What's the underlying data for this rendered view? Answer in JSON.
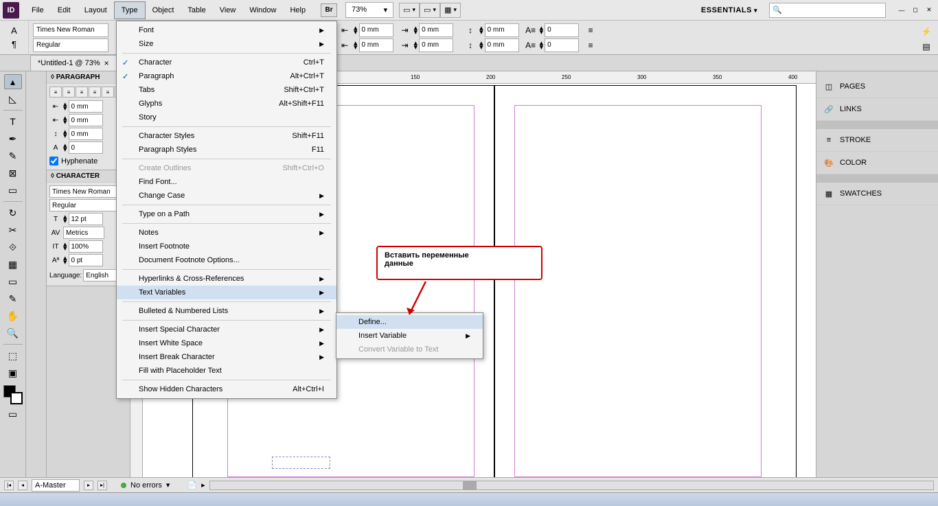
{
  "menubar": {
    "app": "ID",
    "items": [
      "File",
      "Edit",
      "Layout",
      "Type",
      "Object",
      "Table",
      "View",
      "Window",
      "Help"
    ],
    "active_index": 3,
    "br": "Br",
    "zoom": "73%",
    "workspace": "ESSENTIALS",
    "search_placeholder": ""
  },
  "controlbar": {
    "font_family": "Times New Roman",
    "font_style": "Regular",
    "indent_val": "0 mm",
    "space_val": "0 mm",
    "num_val": "0"
  },
  "doc_tab": {
    "title": "*Untitled-1 @ 73%"
  },
  "paragraph_panel": {
    "title": "◊ PARAGRAPH",
    "val_mm": "0 mm",
    "val_num": "0",
    "hyphenate": "Hyphenate"
  },
  "character_panel": {
    "title": "◊ CHARACTER",
    "font": "Times New Roman",
    "style": "Regular",
    "size": "12 pt",
    "metrics": "Metrics",
    "scale": "100%",
    "baseline": "0 pt",
    "lang_label": "Language:",
    "lang_value": "English"
  },
  "ruler_ticks": [
    "150",
    "200",
    "250",
    "300",
    "350",
    "400"
  ],
  "right_panels": {
    "pages": "PAGES",
    "links": "LINKS",
    "stroke": "STROKE",
    "color": "COLOR",
    "swatches": "SWATCHES"
  },
  "type_menu": {
    "font": "Font",
    "size": "Size",
    "character": {
      "label": "Character",
      "shortcut": "Ctrl+T"
    },
    "paragraph": {
      "label": "Paragraph",
      "shortcut": "Alt+Ctrl+T"
    },
    "tabs": {
      "label": "Tabs",
      "shortcut": "Shift+Ctrl+T"
    },
    "glyphs": {
      "label": "Glyphs",
      "shortcut": "Alt+Shift+F11"
    },
    "story": "Story",
    "char_styles": {
      "label": "Character Styles",
      "shortcut": "Shift+F11"
    },
    "para_styles": {
      "label": "Paragraph Styles",
      "shortcut": "F11"
    },
    "outlines": {
      "label": "Create Outlines",
      "shortcut": "Shift+Ctrl+O"
    },
    "find_font": "Find Font...",
    "change_case": "Change Case",
    "type_path": "Type on a Path",
    "notes": "Notes",
    "footnote": "Insert Footnote",
    "footnote_opts": "Document Footnote Options...",
    "hyperlinks": "Hyperlinks & Cross-References",
    "text_vars": "Text Variables",
    "bulleted": "Bulleted & Numbered Lists",
    "special_char": "Insert Special Character",
    "white_space": "Insert White Space",
    "break_char": "Insert Break Character",
    "placeholder": "Fill with Placeholder Text",
    "hidden": {
      "label": "Show Hidden Characters",
      "shortcut": "Alt+Ctrl+I"
    }
  },
  "submenu": {
    "define": "Define...",
    "insert": "Insert Variable",
    "convert": "Convert Variable to Text"
  },
  "callout": {
    "line1": "Вставить переменные",
    "line2": "данные"
  },
  "statusbar": {
    "page": "A-Master",
    "errors": "No errors"
  }
}
